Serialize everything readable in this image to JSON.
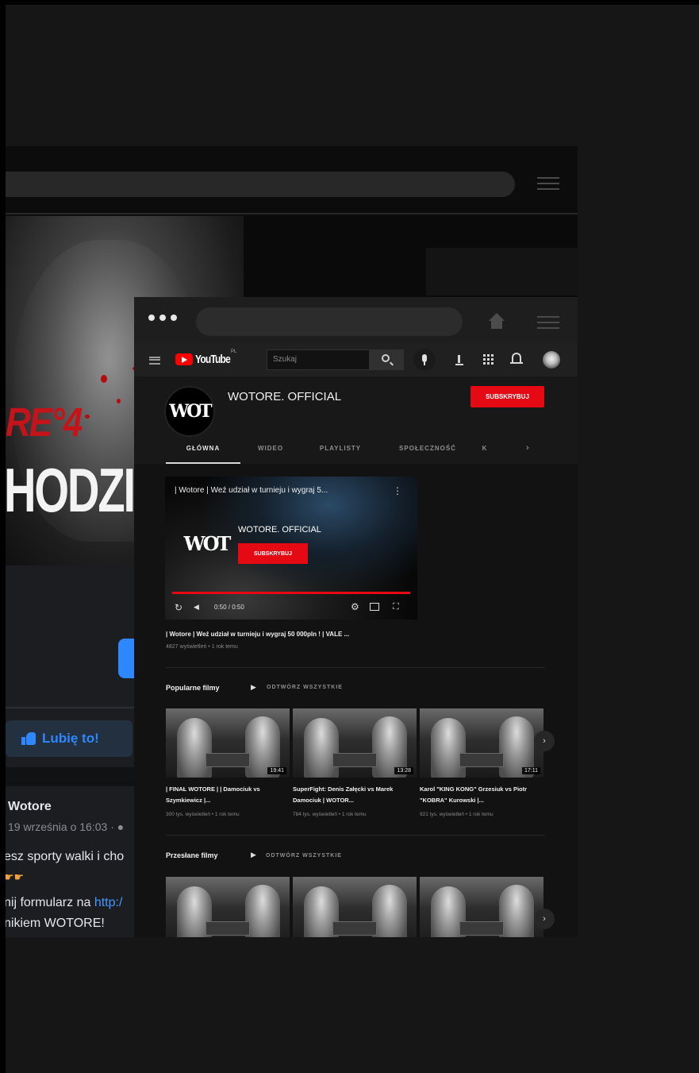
{
  "colors": {
    "youtube_red": "#e50914",
    "facebook_blue": "#2d88ff",
    "dark_bg": "#0f0f0f"
  },
  "facebook": {
    "cover": {
      "logo_text": "RE°4",
      "headline": "HODZI"
    },
    "like_button_label": "Lubię to!",
    "post": {
      "page_name": "Wotore",
      "timestamp": "19 września o 16:03 · ●",
      "line1": "esz sporty walki i cho",
      "emoji": "☛☛",
      "line2_prefix": "nij formularz na ",
      "line2_link": "http:/",
      "line3": "nikiem WOTORE!"
    }
  },
  "browser": {
    "dots_icon": "three-dots-icon",
    "home_icon": "home-icon",
    "menu_icon": "hamburger-icon"
  },
  "youtube": {
    "logo_text": "YouTube",
    "logo_region": "PL",
    "search_placeholder": "Szukaj",
    "channel": {
      "avatar_text": "WOT",
      "name": "WOTORE. OFFICIAL",
      "subscribe_label": "SUBSKRYBUJ",
      "tabs": [
        "GŁÓWNA",
        "WIDEO",
        "PLAYLISTY",
        "SPOŁECZNOŚĆ",
        "K"
      ],
      "tabs_more_icon": "›"
    },
    "featured": {
      "player_title": "| Wotore | Weź udział w turnieju i wygraj 5...",
      "more_icon": "⋮",
      "overlay_channel": "WOTORE. OFFICIAL",
      "overlay_subscribe": "SUBSKRYBUJ",
      "replay_icon": "↻",
      "volume_icon": "◀",
      "time": "0:50 / 0:50",
      "settings_icon": "⚙",
      "fullscreen_icon": "⛶",
      "title": "| Wotore | Weź udział w turnieju i wygraj 50 000pln ! | VALE ...",
      "meta": "4827 wyświetleń • 1 rok temu",
      "progress": 1.0
    },
    "popular": {
      "title": "Popularne filmy",
      "play_icon": "▶",
      "play_all": "ODTWÓRZ WSZYSTKIE",
      "next_icon": "›",
      "videos": [
        {
          "title": "| FINAŁ WOTORE | | Damociuk vs Szymkiewicz |...",
          "meta": "300 tys. wyświetleń • 1 rok temu",
          "duration": "19:41"
        },
        {
          "title": "SuperFight: Denis Załęcki vs Marek Damociuk | WOTOR...",
          "meta": "784 tys. wyświetleń • 1 rok temu",
          "duration": "13:28"
        },
        {
          "title": "Karol \"KING KONG\" Grzesiuk vs Piotr \"KOBRA\" Kurowski |...",
          "meta": "921 tys. wyświetleń • 1 rok temu",
          "duration": "17:11"
        }
      ]
    },
    "uploads": {
      "title": "Przesłane filmy",
      "play_icon": "▶",
      "play_all": "ODTWÓRZ WSZYSTKIE",
      "next_icon": "›"
    }
  }
}
